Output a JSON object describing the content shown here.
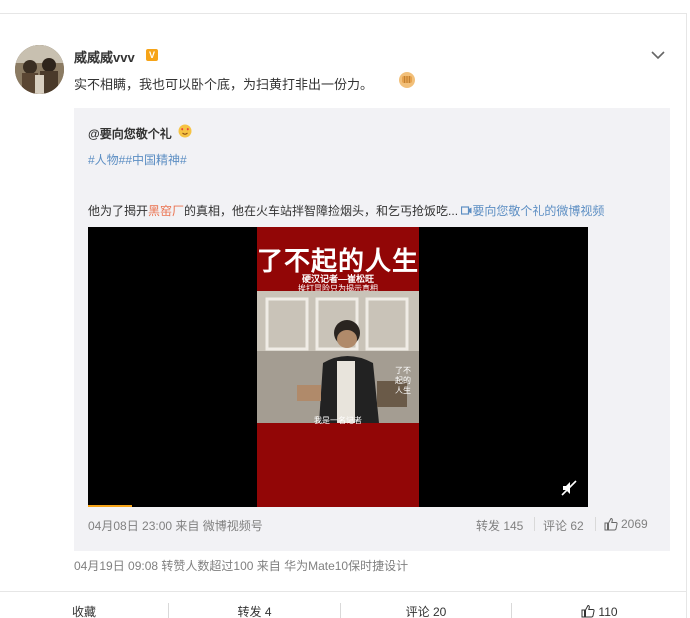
{
  "post": {
    "username": "威威威vvv",
    "verified_badge": "V",
    "text": "实不相瞒，我也可以卧个底，为扫黄打非出一份力。",
    "emoji_icon": "fist-emoji-icon"
  },
  "repost": {
    "original_user": "@要向您敬个礼",
    "tags": "#人物##中国精神#",
    "text_before": "他为了揭开",
    "text_highlight": "黑窑厂",
    "text_after": "的真相，他在火车站拌智障捡烟头，和乞丐抢饭吃...",
    "video_link": "要向您敬个礼的微博视频",
    "video": {
      "title": "了不起的人生",
      "subtitle1": "硬汉记者—崔松旺",
      "subtitle2": "挨打冒险只为揭示真相",
      "caption": "我是一名记者",
      "side_text": "了不起的人生"
    },
    "timestamp": "04月08日 23:00 来自 微博视频号",
    "repost_label": "转发 145",
    "comment_label": "评论 62",
    "like_count": "2069"
  },
  "footer_meta": "04月19日 09:08 转赞人数超过100  来自 华为Mate10保时捷设计",
  "actions": {
    "favorite": "收藏",
    "repost": "转发 4",
    "comment": "评论 20",
    "like": "110"
  },
  "colors": {
    "link": "#5c8ec3",
    "highlight": "#eb7350",
    "badge": "#f6a418",
    "video_panel": "#920606"
  }
}
